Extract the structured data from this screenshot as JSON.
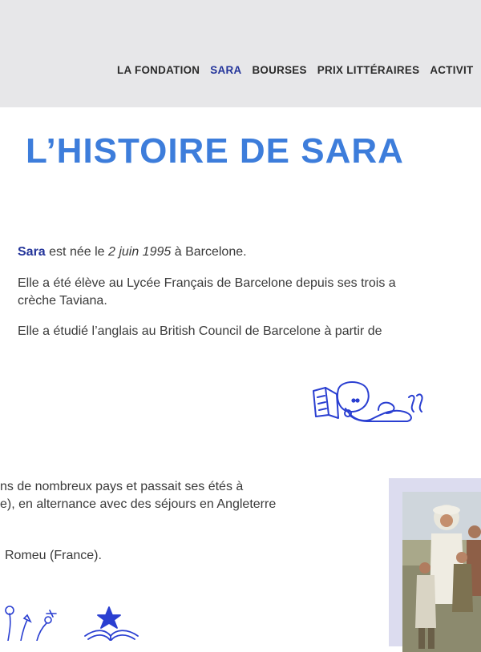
{
  "nav": {
    "items": [
      "LA FONDATION",
      "SARA",
      "BOURSES",
      "PRIX LITTÉRAIRES",
      "ACTIVIT"
    ],
    "active": "SARA"
  },
  "page": {
    "title": "L’HISTOIRE DE SARA"
  },
  "intro": {
    "name": "Sara",
    "born_text": " est née le ",
    "date": "2 juin 1995",
    "born_place": " à Barcelone.",
    "school_line1": "Elle a été élève au Lycée Français de Barcelone depuis ses trois a",
    "school_line2": "crèche Taviana.",
    "english_line": "Elle a étudié l’anglais au British Council de Barcelone à partir de"
  },
  "travel": {
    "line1": "ns de nombreux pays et passait ses étés à",
    "line2": "e), en alternance avec des séjours en Angleterre",
    "line3": "Romeu (France)."
  },
  "colors": {
    "accent_title": "#3d7ddb",
    "accent_nav": "#23349a",
    "doodle": "#2a3fd1"
  }
}
